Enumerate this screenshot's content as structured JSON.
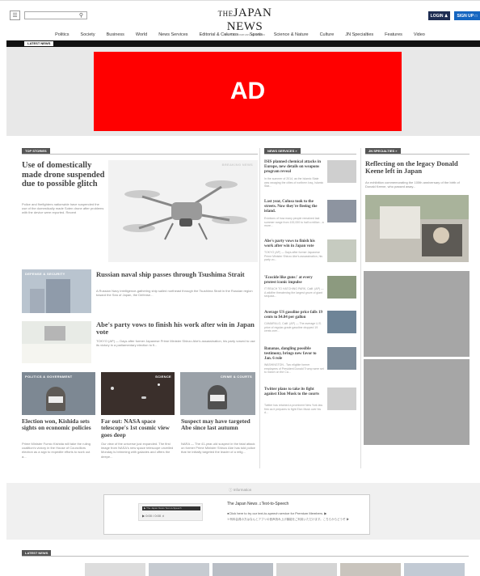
{
  "header": {
    "search_placeholder": "",
    "logo_the": "THE",
    "logo_name": "JAPAN NEWS",
    "logo_sub": "BY THE YOMIURI SHIMBUN",
    "login_label": "LOGIN",
    "signup_label": "SIGN UP"
  },
  "nav": {
    "items": [
      "Politics",
      "Society",
      "Business",
      "World",
      "News Services",
      "Editorial & Columns",
      "Sports",
      "Science & Nature",
      "Culture",
      "JN Specialties",
      "Features",
      "Video"
    ]
  },
  "latest_news_tag": "LATEST NEWS",
  "ad": {
    "label": "AD"
  },
  "top_stories": {
    "label": "TOP STORIES",
    "lead": {
      "headline": "Use of domestically made drone suspended due to possible glitch",
      "body": "Police and firefighters nationwide have suspended the use of the domestically made Soten drone after problems with the device were reported. Recent",
      "photo_label": "BREAKING NEWS"
    },
    "story2": {
      "photo_label": "DEFENSE & SECURITY",
      "headline": "Russian naval ship passes through Tsushima Strait",
      "body": "A Russian Navy intelligence-gathering ship sailed northeast through the Tsushima Strait in the Russian region toward the Sea of Japan, the Defense..."
    },
    "story3": {
      "headline": "Abe's party vows to finish his work after win in Japan vote",
      "body": "TOKYO (AP) — Days after former Japanese Prime Minister Shinzo Abe's assassination, his party vowed to use its victory in a parliamentary election to fi..."
    },
    "cards": [
      {
        "photo_label": "POLITICS & GOVERNMENT",
        "headline": "Election won, Kishida sets sights on economic policies",
        "body": "Prime Minister Fumio Kishida will take the ruling coalition's victory in the House of Councillors election as a sign to expedite efforts to work out a..."
      },
      {
        "photo_label": "SCIENCE",
        "headline": "Far out: NASA space telescope's 1st cosmic view goes deep",
        "body": "Our view of the universe just expanded. The first image from NASA's new space telescope unveiled Monday is brimming with galaxies and offers the deepe..."
      },
      {
        "photo_label": "CRIME & COURTS",
        "headline": "Suspect may have targeted Abe since last autumn",
        "body": "NARA — The 41-year-old suspect in the fatal attack on former Prime Minister Shinzo Abe has told police that he initially targeted the leader of a relig..."
      }
    ]
  },
  "news_services": {
    "label": "NEWS SERVICES",
    "items": [
      {
        "headline": "ISIS planned chemical attacks in Europe, new details on weapons program reveal",
        "body": "In the summer of 2014, as the Islamic State was ravaging the cities of northern Iraq, Islamic Stat..."
      },
      {
        "headline": "Last year, Colusa took to the streets. Now they're fleeing the island.",
        "body": "Evictions of how many people remained last summer range from 100,000 to half a million - a more..."
      },
      {
        "headline": "Abe's party vows to finish his work after win in Japan vote",
        "body": "TOKYO (AP) — Days after former Japanese Prime Minister Shinzo Abe's assassination, his party vo..."
      },
      {
        "headline": "'Ecocide like guns:' at every protest iconic impulse",
        "body": "IT REACH TO HATCHING PARK, Calif. (AP) — A wildfire threatening the largest grove of giant sequoia..."
      },
      {
        "headline": "Average US gasoline price falls 19 cents to $4.84 per gallon",
        "body": "CAMARILLO, Calif. (AP) — The average U.S. price of regular-grade gasoline dropped 19 cents over..."
      },
      {
        "headline": "Bananas, dangling possible testimony, brings new favor to Jan. 6 role",
        "body": "WASHINGTON - Two eligible former employees of President Donald Trump were set to march on the Ca..."
      },
      {
        "headline": "Twitter plans to take its fight against Elon Musk to the courts",
        "body": "Twitter has retained a prominent New York law firm as it prepares to fight Elon Musk over his d..."
      }
    ]
  },
  "jn_specialties": {
    "label": "JN SPECIALTIES",
    "headline": "Reflecting on the legacy Donald Keene left in Japan",
    "body": "An exhibition commemorating the 100th anniversary of the birth of Donald Keene, who passed away..."
  },
  "audio": {
    "section_label": "Information",
    "title": "The Japan News ♫Text-to-Speech",
    "line1": "●Click here to try our text-to-speech service for Premium Members. ▶",
    "line2": "※有料会員の方はなんとアプリの音声読み上げ機能をご利用いただけます。こちらからどうぞ ▶",
    "player_title": "▶ The Japan News Text-to-Speech",
    "player_time": "0:00 / 0:00"
  },
  "latest_news": {
    "label": "LATEST NEWS"
  }
}
